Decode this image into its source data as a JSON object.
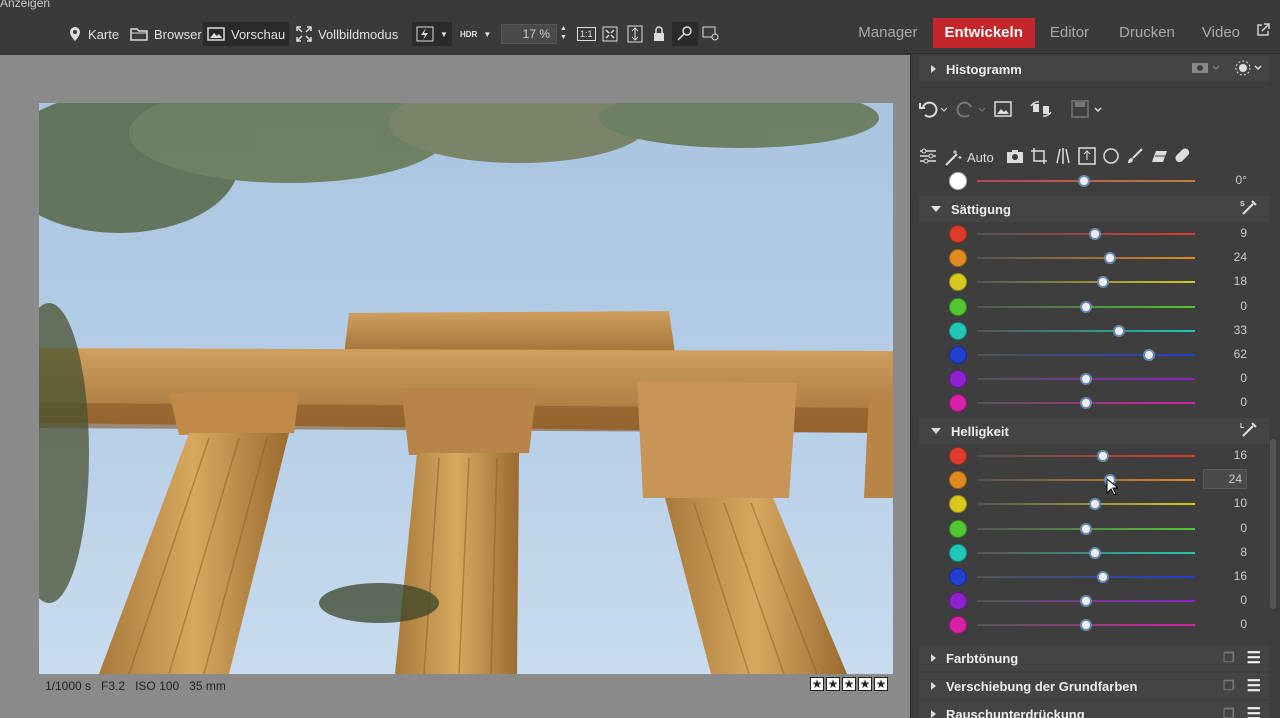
{
  "menu_fragment": "Anzeigen",
  "toolbar": {
    "map": "Karte",
    "browser": "Browser",
    "preview": "Vorschau",
    "fullscreen": "Vollbildmodus",
    "hdr": "HDR",
    "zoom": "17 %",
    "one_to_one": "1:1"
  },
  "modes": [
    "Manager",
    "Entwickeln",
    "Editor",
    "Drucken",
    "Video"
  ],
  "active_mode": "Entwickeln",
  "photo_info": {
    "shutter": "1/1000 s",
    "aperture": "F3.2",
    "iso": "ISO 100",
    "focal": "35 mm"
  },
  "rating": {
    "stars": 5
  },
  "panel": {
    "histogram_title": "Histogramm",
    "auto_label": "Auto",
    "white_row_value": "0°",
    "saturation_title": "Sättigung",
    "brightness_title": "Helligkeit",
    "saturation": [
      {
        "color": "#e03a2a",
        "value": "9",
        "pos": 0.54
      },
      {
        "color": "#e08a20",
        "value": "24",
        "pos": 0.61
      },
      {
        "color": "#d8c820",
        "value": "18",
        "pos": 0.58
      },
      {
        "color": "#50c830",
        "value": "0",
        "pos": 0.5
      },
      {
        "color": "#20c8b8",
        "value": "33",
        "pos": 0.65
      },
      {
        "color": "#2040d0",
        "value": "62",
        "pos": 0.79
      },
      {
        "color": "#9020d0",
        "value": "0",
        "pos": 0.5
      },
      {
        "color": "#d820a8",
        "value": "0",
        "pos": 0.5
      }
    ],
    "brightness": [
      {
        "color": "#e03a2a",
        "value": "16",
        "pos": 0.58
      },
      {
        "color": "#e08a20",
        "value": "24",
        "pos": 0.61
      },
      {
        "color": "#d8c820",
        "value": "10",
        "pos": 0.54
      },
      {
        "color": "#50c830",
        "value": "0",
        "pos": 0.5
      },
      {
        "color": "#20c8b8",
        "value": "8",
        "pos": 0.54
      },
      {
        "color": "#2040d0",
        "value": "16",
        "pos": 0.58
      },
      {
        "color": "#9020d0",
        "value": "0",
        "pos": 0.5
      },
      {
        "color": "#d820a8",
        "value": "0",
        "pos": 0.5
      }
    ],
    "bottom_sections": [
      "Farbtönung",
      "Verschiebung der Grundfarben",
      "Rauschunterdrückung"
    ]
  }
}
